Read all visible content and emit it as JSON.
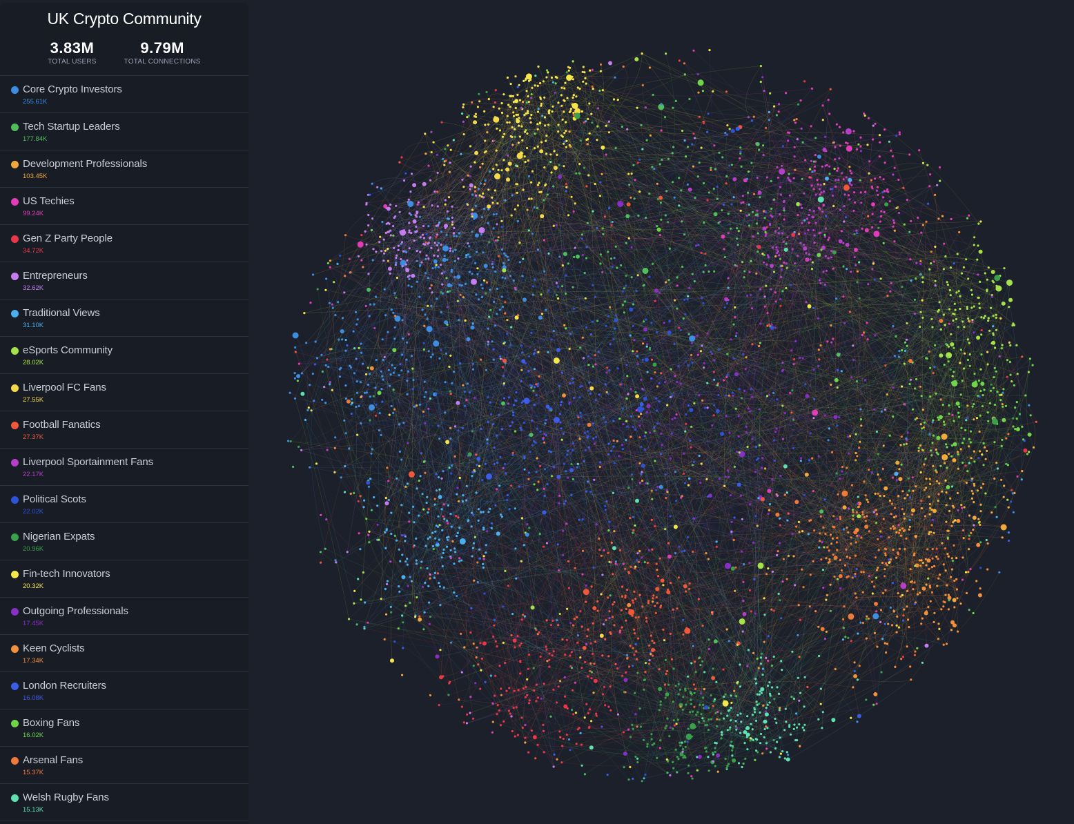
{
  "panel": {
    "title": "UK Crypto Community",
    "stats": [
      {
        "value": "3.83M",
        "label": "TOTAL USERS"
      },
      {
        "value": "9.79M",
        "label": "TOTAL CONNECTIONS"
      }
    ]
  },
  "communities": [
    {
      "name": "Core Crypto Investors",
      "count": "255.61K",
      "color": "#3d8ee3"
    },
    {
      "name": "Tech Startup Leaders",
      "count": "177.84K",
      "color": "#4fbf5c"
    },
    {
      "name": "Development Professionals",
      "count": "103.45K",
      "color": "#f2a93b"
    },
    {
      "name": "US Techies",
      "count": "99.24K",
      "color": "#e23cb8"
    },
    {
      "name": "Gen Z Party People",
      "count": "34.72K",
      "color": "#e8384a"
    },
    {
      "name": "Entrepreneurs",
      "count": "32.62K",
      "color": "#c57ef0"
    },
    {
      "name": "Traditional Views",
      "count": "31.10K",
      "color": "#4bb0f0"
    },
    {
      "name": "eSports Community",
      "count": "28.02K",
      "color": "#a6e34a"
    },
    {
      "name": "Liverpool FC Fans",
      "count": "27.55K",
      "color": "#f5d94a"
    },
    {
      "name": "Football Fanatics",
      "count": "27.37K",
      "color": "#f0583a"
    },
    {
      "name": "Liverpool Sportainment Fans",
      "count": "22.17K",
      "color": "#b53fc9"
    },
    {
      "name": "Political Scots",
      "count": "22.02K",
      "color": "#2f52d6"
    },
    {
      "name": "Nigerian Expats",
      "count": "20.96K",
      "color": "#3aa04a"
    },
    {
      "name": "Fin-tech Innovators",
      "count": "20.32K",
      "color": "#f5e64a"
    },
    {
      "name": "Outgoing Professionals",
      "count": "17.45K",
      "color": "#8a2fc6"
    },
    {
      "name": "Keen Cyclists",
      "count": "17.34K",
      "color": "#f5903a"
    },
    {
      "name": "London Recruiters",
      "count": "16.08K",
      "color": "#3a5ee8"
    },
    {
      "name": "Boxing Fans",
      "count": "16.02K",
      "color": "#6fd64a"
    },
    {
      "name": "Arsenal Fans",
      "count": "15.37K",
      "color": "#ef7a3a"
    },
    {
      "name": "Welsh Rugby Fans",
      "count": "15.13K",
      "color": "#5ee0b0"
    }
  ],
  "graph": {
    "background": "#1c202a"
  }
}
